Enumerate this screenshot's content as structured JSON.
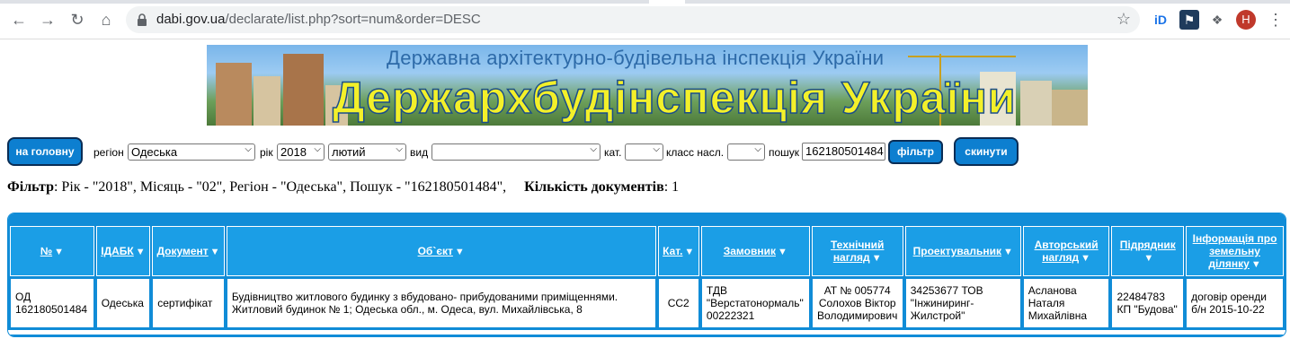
{
  "browser": {
    "url_host": "dabi.gov.ua",
    "url_path": "/declarate/list.php?sort=num&order=DESC",
    "profile_initial": "Н"
  },
  "banner": {
    "subtitle": "Державна архітектурно-будівельна інспекція України",
    "title": "Держархбудінспекція України"
  },
  "filters": {
    "home_button": "на головну",
    "region_label": "регіон",
    "region_value": "Одеська",
    "year_label": "рік",
    "year_value": "2018",
    "month_value": "лютий",
    "type_label": "вид",
    "type_value": "",
    "category_label": "кат.",
    "category_value": "",
    "class_label": "класс насл.",
    "class_value": "",
    "search_label": "пошук",
    "search_value": "162180501484",
    "filter_button": "фільтр",
    "reset_button": "скинути"
  },
  "summary": {
    "filter_label": "Фільтр",
    "filter_text": ": Рік - \"2018\", Місяць - \"02\", Регіон - \"Одеська\", Пошук - \"162180501484\",",
    "count_label": "Кількість документів",
    "count_value": ": 1"
  },
  "table": {
    "columns": [
      {
        "key": "num",
        "label": "№"
      },
      {
        "key": "idabk",
        "label": "ІДАБК"
      },
      {
        "key": "doc",
        "label": "Документ"
      },
      {
        "key": "object",
        "label": "Об`єкт"
      },
      {
        "key": "cat",
        "label": "Кат."
      },
      {
        "key": "customer",
        "label": "Замовник"
      },
      {
        "key": "tech",
        "label": "Технічний нагляд"
      },
      {
        "key": "designer",
        "label": "Проектувальник"
      },
      {
        "key": "author",
        "label": "Авторський нагляд"
      },
      {
        "key": "contractor",
        "label": "Підрядник"
      },
      {
        "key": "land",
        "label": "Інформація про земельну ділянку"
      }
    ],
    "rows": [
      {
        "num": "ОД 162180501484",
        "idabk": "Одеська",
        "doc": "сертифікат",
        "object": "Будівництво житлового будинку з вбудовано- прибудованими приміщеннями. Житловий будинок № 1; Одеська обл., м. Одеса, вул. Михайлівська, 8",
        "cat": "СС2",
        "customer": "ТДВ \"Верстатонормаль\" 00222321",
        "tech": "АТ № 005774 Солохов Віктор Володимирович",
        "designer": "34253677 ТОВ \"Інжиниринг-Жилстрой\"",
        "author": "Асланова Наталя Михайлівна",
        "contractor": "22484783 КП \"Будова\"",
        "land": "договір оренди б/н 2015-10-22"
      }
    ]
  }
}
